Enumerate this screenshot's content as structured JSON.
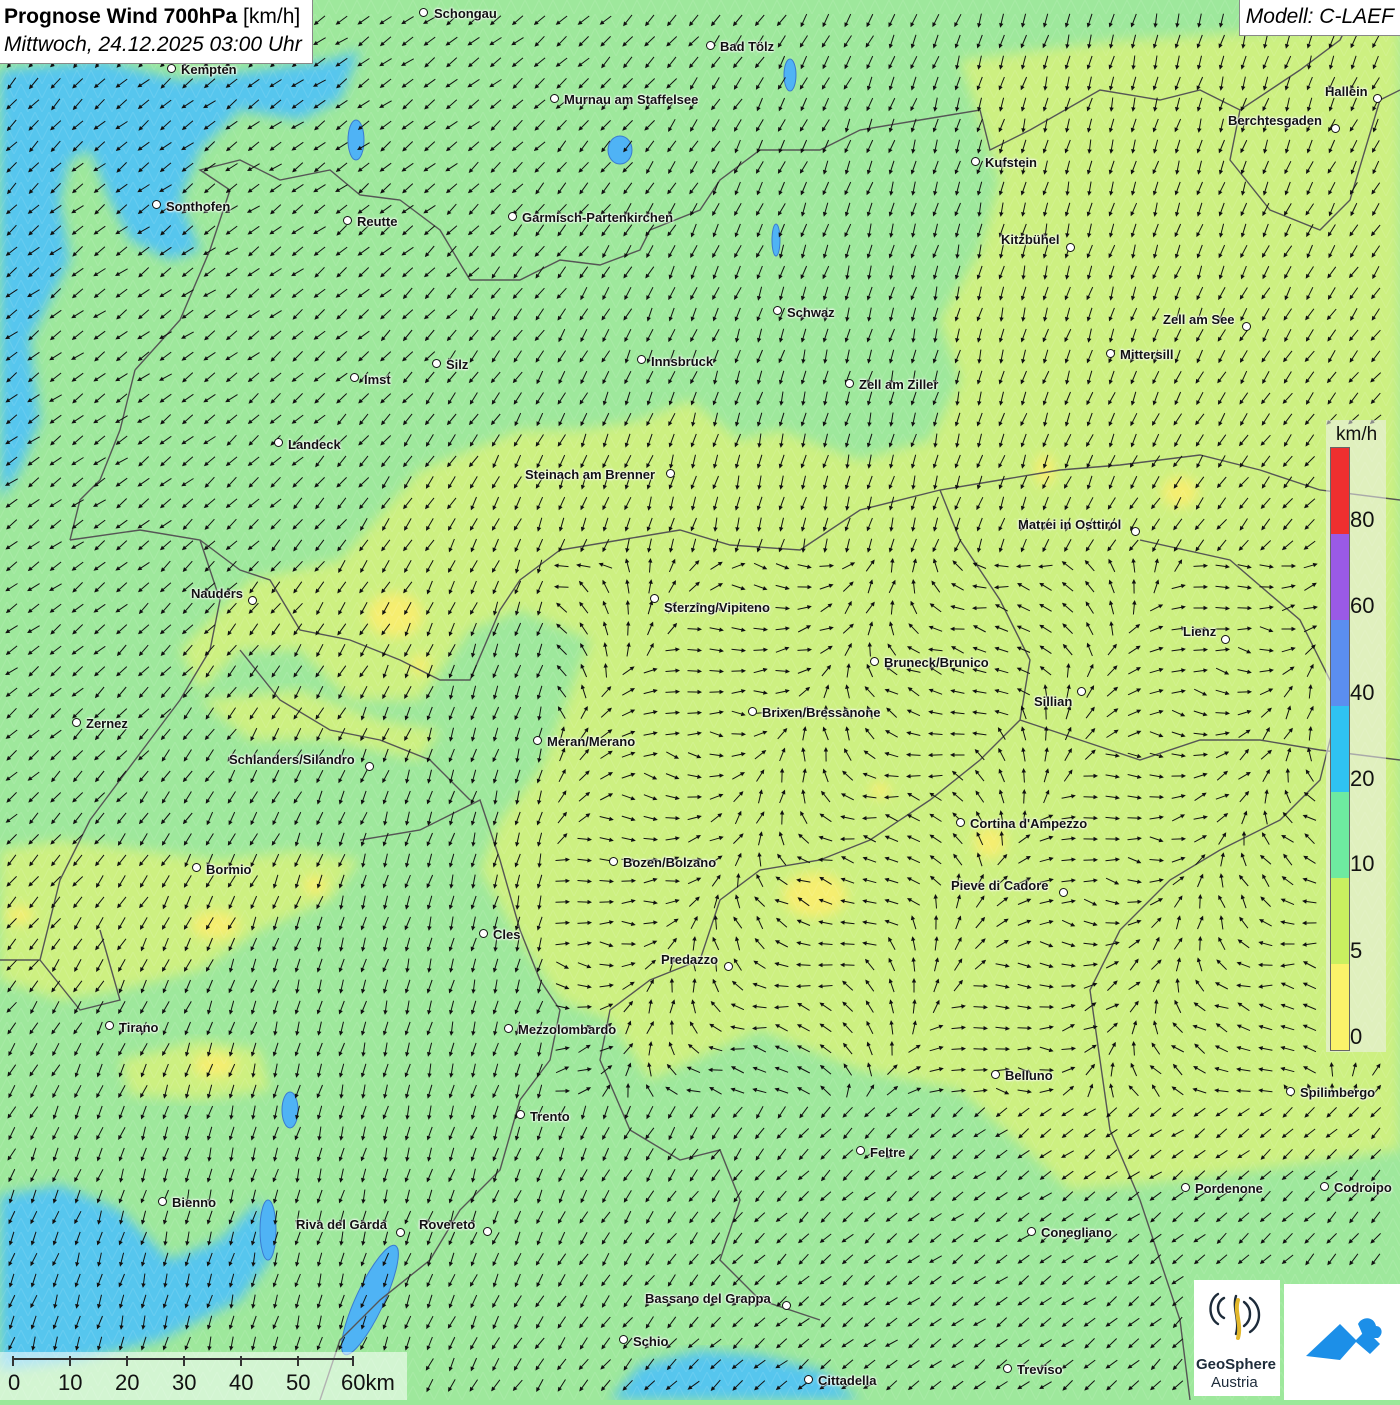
{
  "header": {
    "title_bold": "Prognose Wind 700hPa",
    "title_unit": "[km/h]",
    "datetime": "Mittwoch, 24.12.2025 03:00 Uhr",
    "model": "Modell: C-LAEF"
  },
  "legend": {
    "unit": "km/h",
    "labels": [
      "80",
      "60",
      "40",
      "20",
      "10",
      "5",
      "0"
    ],
    "colors": [
      "#ef2f2f",
      "#9a5ae6",
      "#5b8ef0",
      "#2fc2f2",
      "#6eeaa0",
      "#c9f060",
      "#fbf36a"
    ]
  },
  "scale_bar": {
    "labels": [
      "0",
      "10",
      "20",
      "30",
      "40",
      "50",
      "60km"
    ]
  },
  "cities": [
    {
      "name": "Schongau"
    },
    {
      "name": "Kempten"
    },
    {
      "name": "Bad Tölz"
    },
    {
      "name": "Murnau am Staffelsee"
    },
    {
      "name": "Hallein"
    },
    {
      "name": "Berchtesgaden"
    },
    {
      "name": "Kufstein"
    },
    {
      "name": "Sonthofen"
    },
    {
      "name": "Reutte"
    },
    {
      "name": "Garmisch-Partenkirchen"
    },
    {
      "name": "Kitzbühel"
    },
    {
      "name": "Schwaz"
    },
    {
      "name": "Zell am See"
    },
    {
      "name": "Mittersill"
    },
    {
      "name": "Silz"
    },
    {
      "name": "Innsbruck"
    },
    {
      "name": "Imst"
    },
    {
      "name": "Zell am Ziller"
    },
    {
      "name": "Landeck"
    },
    {
      "name": "Steinach am Brenner"
    },
    {
      "name": "Matrei in Osttirol"
    },
    {
      "name": "Nauders"
    },
    {
      "name": "Sterzing/Vipiteno"
    },
    {
      "name": "Lienz"
    },
    {
      "name": "Bruneck/Brunico"
    },
    {
      "name": "Sillian"
    },
    {
      "name": "Zernez"
    },
    {
      "name": "Brixen/Bressanone"
    },
    {
      "name": "Meran/Merano"
    },
    {
      "name": "Schlanders/Silandro"
    },
    {
      "name": "Cortina d'Ampezzo"
    },
    {
      "name": "Bozen/Bolzano"
    },
    {
      "name": "Bormio"
    },
    {
      "name": "Pieve di Cadore"
    },
    {
      "name": "Cles"
    },
    {
      "name": "Predazzo"
    },
    {
      "name": "Tirano"
    },
    {
      "name": "Mezzolombardo"
    },
    {
      "name": "Belluno"
    },
    {
      "name": "Spilimbergo"
    },
    {
      "name": "Trento"
    },
    {
      "name": "Feltre"
    },
    {
      "name": "Pordenone"
    },
    {
      "name": "Codroipo"
    },
    {
      "name": "Bienno"
    },
    {
      "name": "Riva del Garda"
    },
    {
      "name": "Rovereto"
    },
    {
      "name": "Conegliano"
    },
    {
      "name": "Bassano del Grappa"
    },
    {
      "name": "Schio"
    },
    {
      "name": "Treviso"
    },
    {
      "name": "Cittadella"
    }
  ],
  "logos": {
    "geosphere_line1": "GeoSphere",
    "geosphere_line2": "Austria"
  },
  "colors": {
    "wind_0_5": "#fbf36a",
    "wind_5_10": "#c9f060",
    "wind_10_20": "#6eeaa0",
    "wind_20_40": "#2fc2f2",
    "lake": "#4fb3f5",
    "border": "#555555",
    "arrow": "#111111"
  }
}
